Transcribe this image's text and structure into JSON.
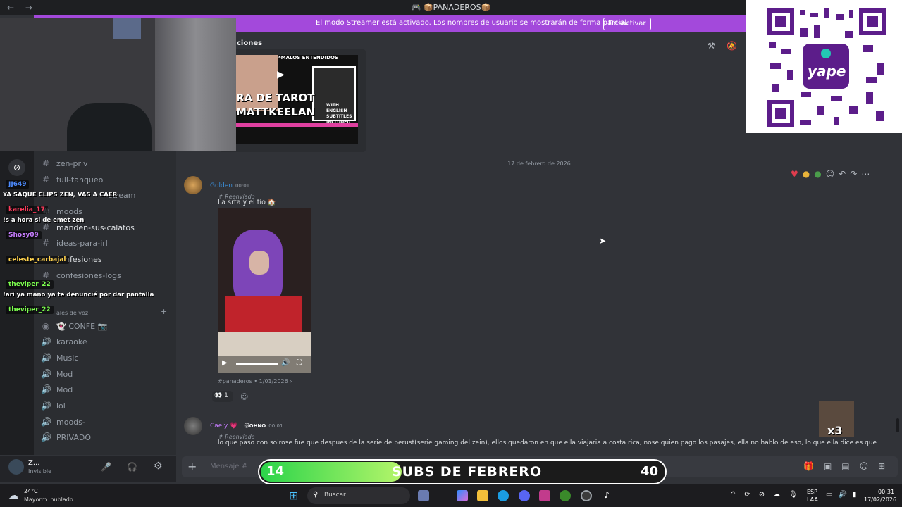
{
  "window": {
    "nav": "← →",
    "title": "🎮 📦PANADEROS📦"
  },
  "streamer_bar": {
    "message": "El modo Streamer está activado. Los nombres de usuario se mostrarán de forma parcial.",
    "button": "Desactivar"
  },
  "header": {
    "channel_fragment": "ciones"
  },
  "thumbnail": {
    "top_label": "*MALOS ENTENDIDOS",
    "line1": "RA DE TAROT",
    "line2": "MATTKEELAN",
    "badge": "WITH ENGLISH SUBTITLES INCLUDED"
  },
  "sidebar": {
    "channels": [
      {
        "icon": "#",
        "label": "zen-priv"
      },
      {
        "icon": "#",
        "label": "full-tanqueo"
      },
      {
        "icon": "#",
        "label": "-stream"
      },
      {
        "icon": "#",
        "label": "moods"
      },
      {
        "icon": "#",
        "label": "manden-sus-calatos"
      },
      {
        "icon": "#",
        "label": "ideas-para-irl"
      },
      {
        "icon": "#",
        "label": "nfesiones"
      },
      {
        "icon": "#",
        "label": "confesiones-logs"
      }
    ],
    "voice_header": "ales de voz",
    "voice_channels": [
      {
        "icon": "◉",
        "label": "👻 CONFE 📷"
      },
      {
        "icon": "🔊",
        "label": "karaoke"
      },
      {
        "icon": "🔊",
        "label": "Music"
      },
      {
        "icon": "🔊",
        "label": "Mod"
      },
      {
        "icon": "🔊",
        "label": "Mod"
      },
      {
        "icon": "🔊",
        "label": "lol"
      },
      {
        "icon": "🔊",
        "label": "moods-"
      },
      {
        "icon": "🔊",
        "label": "PRIVADO"
      }
    ]
  },
  "chat_overlay": [
    {
      "name": "JJ649",
      "color": "#4d8cff",
      "message": "YA SAQUE CLIPS ZEN, VAS A CAER"
    },
    {
      "name": "karelia_17",
      "color": "#ff3b5c",
      "message": "!s a hora si de emet zen"
    },
    {
      "name": "Shosy09",
      "color": "#c77dff",
      "message": ""
    },
    {
      "name": "celeste_carbajal",
      "color": "#ffd24d",
      "message": ""
    },
    {
      "name": "theviper_22",
      "color": "#7cff4d",
      "message": "!ari ya mano ya te denuncié por dar pantalla"
    },
    {
      "name": "theviper_22",
      "color": "#7cff4d",
      "message": ""
    }
  ],
  "messages": {
    "date_separator": "17 de febrero de 2026",
    "first": {
      "author": "Golden",
      "author_color": "#3b8ed8",
      "time": "00:01",
      "forwarded": "Reenviado",
      "text": "La srta y el tio 🏠",
      "source": "#panaderos",
      "source_date": "1/01/2026",
      "reaction_emoji": "👀",
      "reaction_count": "1"
    },
    "second": {
      "author": "Caely 💗",
      "author_color": "#c77dff",
      "tag": "🐱OHÑO",
      "time": "00:01",
      "forwarded": "Reenviado",
      "text": "lo que paso con solrose fue que despues de la serie de perust(serie gaming del zein), ellos quedaron en que ella viajaria a costa rica, nose  quien pago los pasajes, ella no hablo de eso, lo que ella dice es que"
    }
  },
  "composer": {
    "placeholder": "Mensaje #"
  },
  "subs_goal": {
    "current": "14",
    "label": "SUBS DE FEBRERO",
    "target": "40",
    "progress": 0.35
  },
  "user_panel": {
    "name": "Z...",
    "status": "Invisible"
  },
  "taskbar": {
    "weather_temp": "24°C",
    "weather_desc": "Mayorm. nublado",
    "search": "Buscar",
    "lang1": "ESP",
    "lang2": "LAA",
    "clock_time": "00:31",
    "clock_date": "17/02/2026"
  },
  "qr": {
    "brand": "yape"
  },
  "sticker": {
    "text": "x3"
  },
  "colors": {
    "streamer_bar": "#a349db",
    "accent_green": "#2bd44a"
  }
}
